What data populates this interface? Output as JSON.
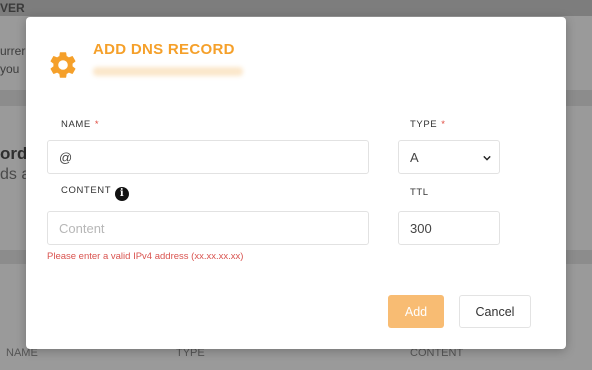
{
  "background": {
    "topbar_text": "VER",
    "partial_line_1": "urrer",
    "partial_line_2": "you",
    "big_text_1": "ord",
    "big_text_2": "ds a",
    "column_headers": [
      "NAME",
      "TYPE",
      "CONTENT"
    ]
  },
  "modal": {
    "title": "ADD DNS RECORD",
    "icon": "gear-icon",
    "fields": {
      "name": {
        "label": "NAME",
        "required_mark": "*",
        "value": "@"
      },
      "type": {
        "label": "TYPE",
        "required_mark": "*",
        "value": "A"
      },
      "content": {
        "label": "CONTENT",
        "info_glyph": "i",
        "placeholder": "Content"
      },
      "ttl": {
        "label": "TTL",
        "value": "300"
      }
    },
    "error_message": "Please enter a valid IPv4 address (xx.xx.xx.xx)",
    "buttons": {
      "add": "Add",
      "cancel": "Cancel"
    }
  },
  "colors": {
    "accent": "#f5a02a",
    "error": "#d9534f",
    "add_button": "#f8bc73"
  }
}
